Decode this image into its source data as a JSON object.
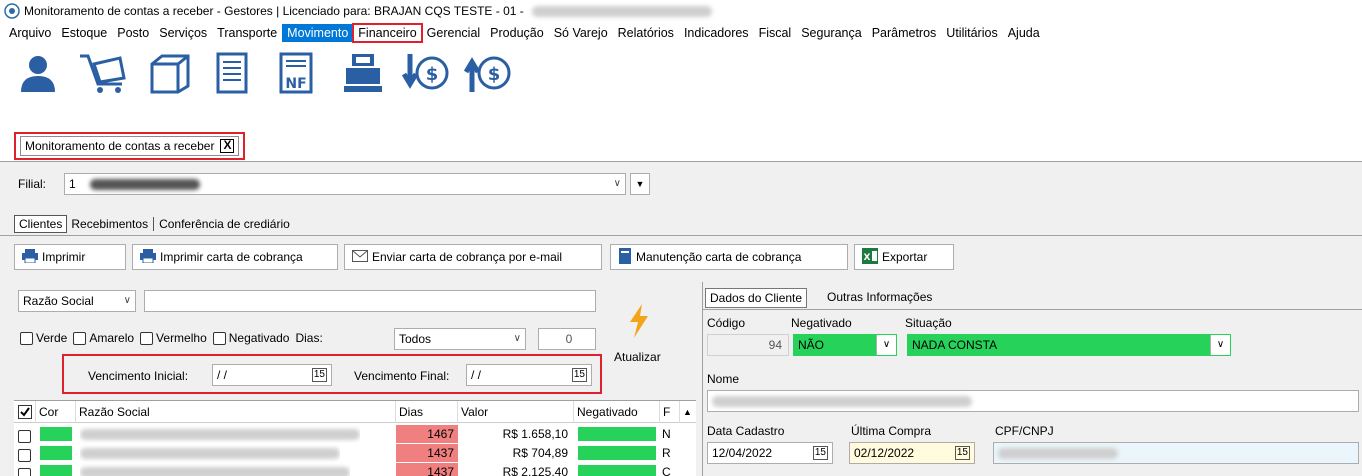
{
  "window": {
    "title": "Monitoramento de contas a receber - Gestores | Licenciado para: BRAJAN CQS TESTE - 01 -"
  },
  "menu": [
    {
      "label": "Arquivo"
    },
    {
      "label": "Estoque"
    },
    {
      "label": "Posto"
    },
    {
      "label": "Serviços"
    },
    {
      "label": "Transporte"
    },
    {
      "label": "Movimento"
    },
    {
      "label": "Financeiro"
    },
    {
      "label": "Gerencial"
    },
    {
      "label": "Produção"
    },
    {
      "label": "Só Varejo"
    },
    {
      "label": "Relatórios"
    },
    {
      "label": "Indicadores"
    },
    {
      "label": "Fiscal"
    },
    {
      "label": "Segurança"
    },
    {
      "label": "Parâmetros"
    },
    {
      "label": "Utilitários"
    },
    {
      "label": "Ajuda"
    }
  ],
  "toolbar_icons": [
    "user-icon",
    "cart-icon",
    "box-icon",
    "document-icon",
    "nf-icon",
    "cash-register-icon",
    "pay-down-icon",
    "receive-up-icon"
  ],
  "doc_tab": {
    "label": "Monitoramento de contas a receber",
    "close": "X"
  },
  "filial": {
    "label": "Filial:",
    "value": "1"
  },
  "subtabs": [
    "Clientes",
    "Recebimentos",
    "Conferência de crediário"
  ],
  "buttons": {
    "imprimir": "Imprimir",
    "imprimir_carta": "Imprimir carta de cobrança",
    "enviar_carta": "Enviar carta de cobrança por e-mail",
    "manutencao": "Manutenção carta de cobrança",
    "exportar": "Exportar"
  },
  "filters": {
    "search_by": "Razão Social",
    "verde": "Verde",
    "amarelo": "Amarelo",
    "vermelho": "Vermelho",
    "negativado": "Negativado",
    "dias_label": "Dias:",
    "dias_value": "Todos",
    "dias_num": "0",
    "atualizar": "Atualizar",
    "venc_inicial_label": "Vencimento Inicial:",
    "venc_inicial_value": "/ /",
    "venc_final_label": "Vencimento Final:",
    "venc_final_value": "/ /",
    "cal": "15"
  },
  "grid": {
    "headers": [
      "Cor",
      "Razão Social",
      "Dias",
      "Valor",
      "Negativado",
      "F"
    ],
    "rows": [
      {
        "dias": "1467",
        "valor": "R$ 1.658,10",
        "f": "N"
      },
      {
        "dias": "1437",
        "valor": "R$ 704,89",
        "f": "R"
      },
      {
        "dias": "1437",
        "valor": "R$ 2.125,40",
        "f": "C"
      }
    ]
  },
  "details": {
    "tabs": [
      "Dados do Cliente",
      "Outras Informações"
    ],
    "codigo_label": "Código",
    "codigo_value": "94",
    "negativado_label": "Negativado",
    "negativado_value": "NÃO",
    "situacao_label": "Situação",
    "situacao_value": "NADA CONSTA",
    "nome_label": "Nome",
    "data_cadastro_label": "Data Cadastro",
    "data_cadastro_value": "12/04/2022",
    "ultima_compra_label": "Última Compra",
    "ultima_compra_value": "02/12/2022",
    "cpf_label": "CPF/CNPJ",
    "cal": "15"
  },
  "colors": {
    "green": "#27d25a",
    "red_row": "#f08080",
    "highlight": "#e0202a",
    "menu_active": "#0078d7"
  }
}
